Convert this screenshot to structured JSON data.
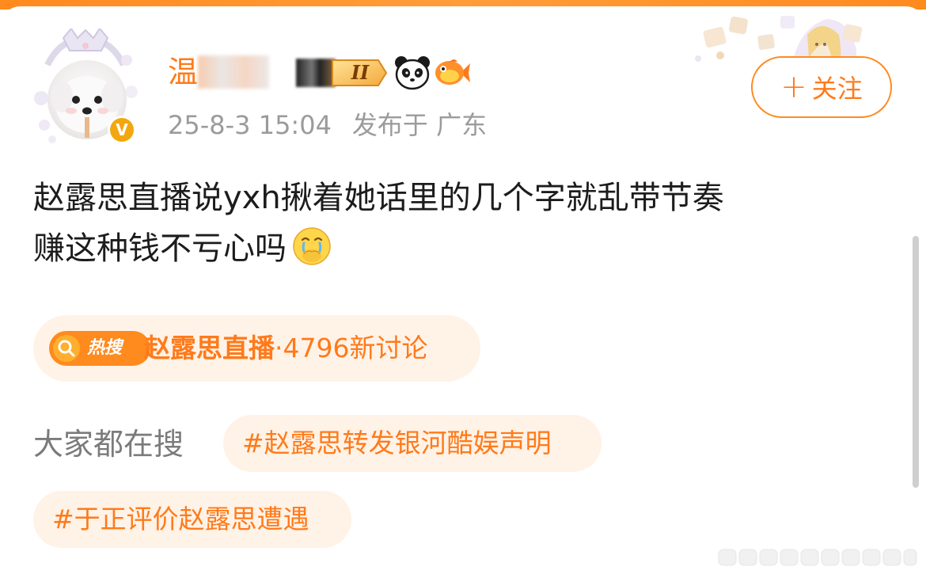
{
  "user": {
    "name_visible": "温",
    "verified_badge": "V"
  },
  "badges": {
    "level": "II",
    "icons": [
      "panda-icon",
      "fish-icon"
    ]
  },
  "post_meta": {
    "date": "25-8-3 15:04",
    "location": "发布于 广东"
  },
  "follow_button": {
    "plus": "+",
    "label": "关注"
  },
  "post": {
    "line1": "赵露思直播说yxh揪着她话里的几个字就乱带节奏",
    "line2": "赚这种钱不亏心吗",
    "emoji": "crying-face-icon"
  },
  "hot_search": {
    "tag_label": "热搜",
    "topic": "赵露思直播",
    "separator": "·",
    "count_text": "4796新讨论"
  },
  "everyone_searching": {
    "label": "大家都在搜",
    "tags": [
      "#赵露思转发银河酷娱声明",
      "#于正评价赵露思遭遇"
    ]
  },
  "colors": {
    "accent": "#ff7a1a",
    "chip_bg": "#fff3e8",
    "text_primary": "#1c1c1c",
    "text_secondary": "#9b9b9b"
  }
}
